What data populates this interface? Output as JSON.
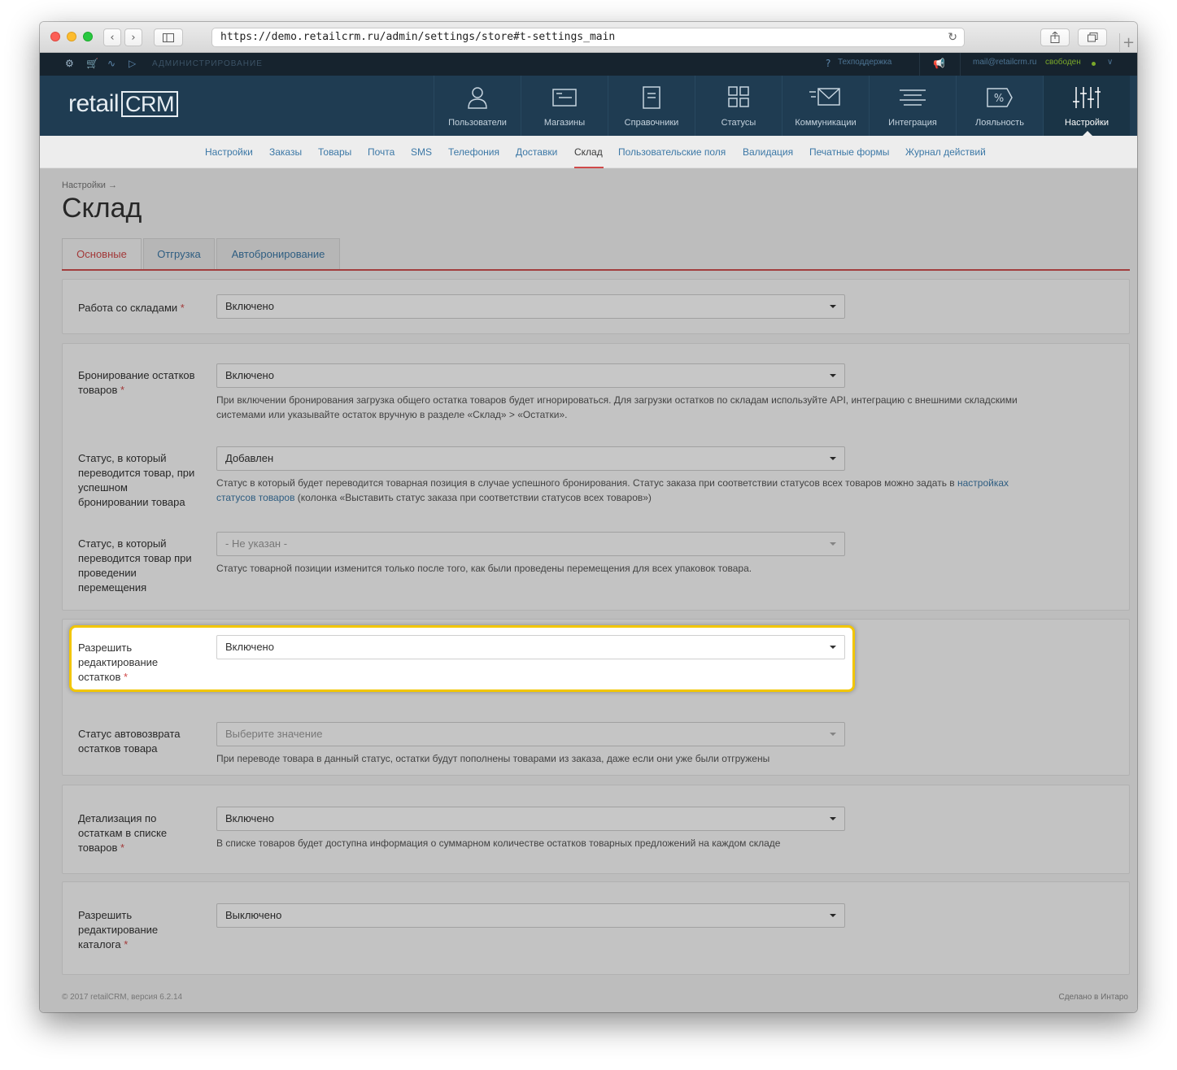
{
  "browser": {
    "url": "https://demo.retailcrm.ru/admin/settings/store#t-settings_main"
  },
  "adminbar": {
    "label": "АДМИНИСТРИРОВАНИЕ",
    "support": "Техподдержка",
    "email": "mail@retailcrm.ru",
    "status": "свободен"
  },
  "logo": {
    "text_left": "retail",
    "text_box": "CRM"
  },
  "main_nav": [
    {
      "label": "Пользователи",
      "icon": "user-icon"
    },
    {
      "label": "Магазины",
      "icon": "store-icon"
    },
    {
      "label": "Справочники",
      "icon": "reference-book-icon"
    },
    {
      "label": "Статусы",
      "icon": "statuses-grid-icon"
    },
    {
      "label": "Коммуникации",
      "icon": "envelope-icon"
    },
    {
      "label": "Интеграция",
      "icon": "integration-lines-icon"
    },
    {
      "label": "Лояльность",
      "icon": "percent-tag-icon"
    },
    {
      "label": "Настройки",
      "icon": "sliders-icon"
    }
  ],
  "sub_nav": [
    "Настройки",
    "Заказы",
    "Товары",
    "Почта",
    "SMS",
    "Телефония",
    "Доставки",
    "Склад",
    "Пользовательские поля",
    "Валидация",
    "Печатные формы",
    "Журнал действий"
  ],
  "sub_nav_active": "Склад",
  "breadcrumb": "Настройки →",
  "page_title": "Склад",
  "tabs": [
    "Основные",
    "Отгрузка",
    "Автобронирование"
  ],
  "fields": {
    "warehouses": {
      "label": "Работа со складами",
      "required": "*",
      "value": "Включено"
    },
    "reserve": {
      "label": "Бронирование остатков товаров",
      "required": "*",
      "value": "Включено",
      "help": "При включении бронирования загрузка общего остатка товаров будет игнорироваться. Для загрузки остатков по складам используйте API, интеграцию с внешними складскими системами или указывайте остаток вручную в разделе «Склад» > «Остатки»."
    },
    "reserve_status": {
      "label": "Статус, в который переводится товар, при успешном бронировании товара",
      "value": "Добавлен",
      "help_before": "Статус в который будет переводится товарная позиция в случае успешного бронирования. Статус заказа при соответствии статусов всех товаров можно задать в ",
      "help_link": "настройках статусов товаров",
      "help_after": " (колонка «Выставить статус заказа при соответствии статусов всех товаров»)"
    },
    "transfer_status": {
      "label": "Статус, в который переводится товар при проведении перемещения",
      "value": "- Не указан -",
      "help": "Статус товарной позиции изменится только после того, как были проведены перемещения для всех упаковок товара."
    },
    "edit_stock": {
      "label": "Разрешить редактирование остатков",
      "required": "*",
      "value": "Включено"
    },
    "autoreturn_status": {
      "label": "Статус автовозврата остатков товара",
      "value": "Выберите значение",
      "help": "При переводе товара в данный статус, остатки будут пополнены товарами из заказа, даже если они уже были отгружены"
    },
    "detail_stock": {
      "label": "Детализация по остаткам в списке товаров",
      "required": "*",
      "value": "Включено",
      "help": "В списке товаров будет доступна информация о суммарном количестве остатков товарных предложений на каждом складе"
    },
    "edit_catalog": {
      "label": "Разрешить редактирование каталога",
      "required": "*",
      "value": "Выключено"
    }
  },
  "footer": {
    "left": "© 2017 retailCRM, версия 6.2.14",
    "right": "Сделано в Интаро"
  },
  "colors": {
    "highlight": "#f2c600",
    "header": "#1f3c52",
    "accent_red": "#d04a4a",
    "link": "#3c78a6"
  }
}
